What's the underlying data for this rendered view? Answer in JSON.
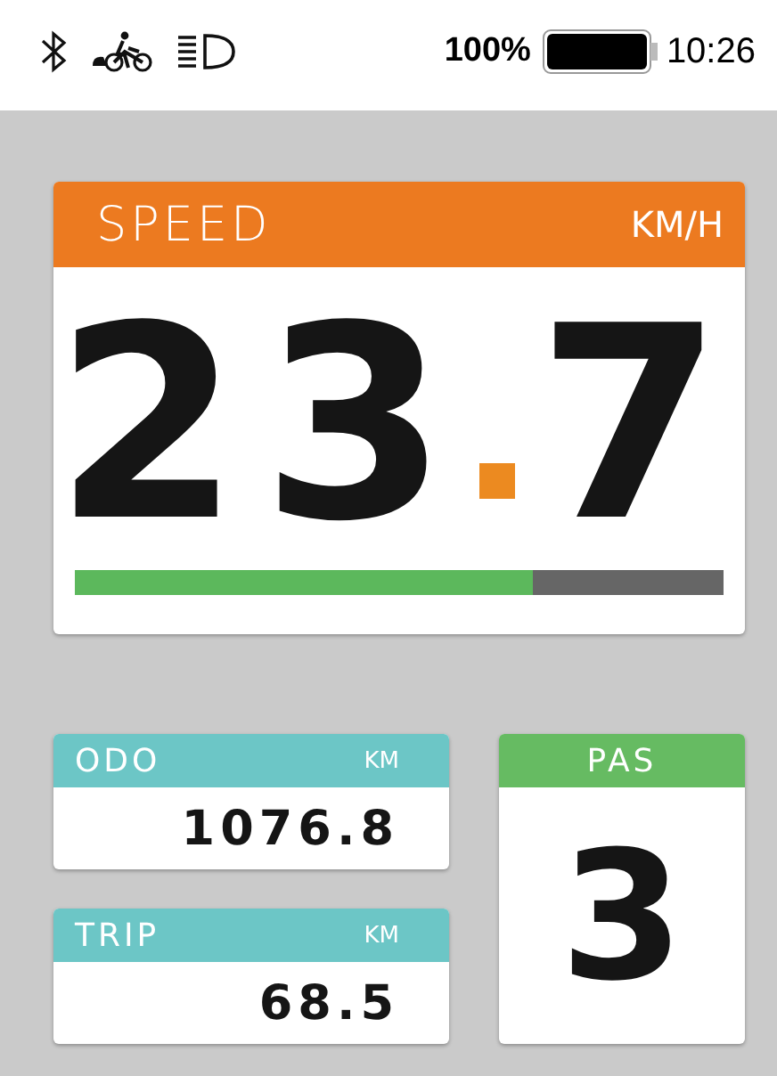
{
  "status_bar": {
    "battery_percent": "100%",
    "time": "10:26"
  },
  "speed": {
    "label": "SPEED",
    "unit": "KM/H",
    "integer": "23",
    "decimal": "7",
    "level": 0.705
  },
  "odo": {
    "label": "ODO",
    "unit": "KM",
    "value": "1076.8"
  },
  "trip": {
    "label": "TRIP",
    "unit": "KM",
    "value": "68.5"
  },
  "pas": {
    "label": "PAS",
    "value": "3"
  }
}
